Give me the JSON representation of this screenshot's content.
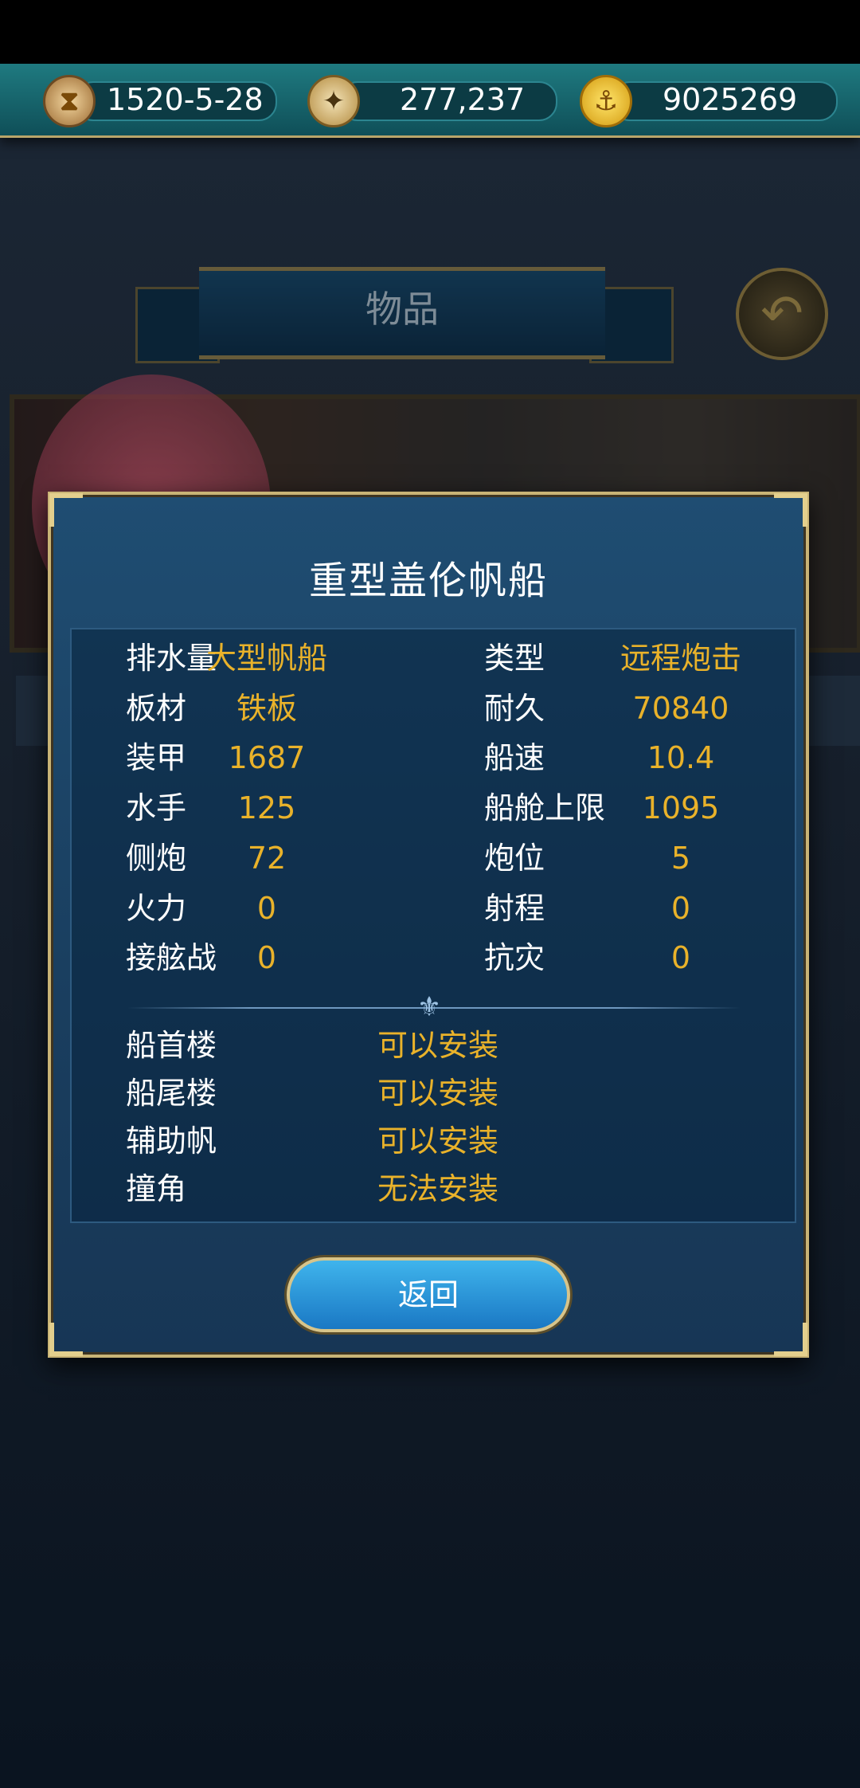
{
  "topbar": {
    "date": "1520-5-28",
    "compass_value": "277,237",
    "coins_value": "9025269",
    "date_icon": "hourglass-icon",
    "compass_icon": "compass-icon",
    "coin_icon": "anchor-coin-icon"
  },
  "page": {
    "title": "物品",
    "back_icon": "back-arrow-icon"
  },
  "modal": {
    "title": "重型盖伦帆船",
    "stats": [
      {
        "label": "排水量",
        "value": "大型帆船",
        "label2": "类型",
        "value2": "远程炮击"
      },
      {
        "label": "板材",
        "value": "铁板",
        "label2": "耐久",
        "value2": "70840"
      },
      {
        "label": "装甲",
        "value": "1687",
        "label2": "船速",
        "value2": "10.4"
      },
      {
        "label": "水手",
        "value": "125",
        "label2": "船舱上限",
        "value2": "1095"
      },
      {
        "label": "侧炮",
        "value": "72",
        "label2": "炮位",
        "value2": "5"
      },
      {
        "label": "火力",
        "value": "0",
        "label2": "射程",
        "value2": "0"
      },
      {
        "label": "接舷战",
        "value": "0",
        "label2": "抗灾",
        "value2": "0"
      }
    ],
    "installs": [
      {
        "label": "船首楼",
        "status": "可以安装"
      },
      {
        "label": "船尾楼",
        "status": "可以安装"
      },
      {
        "label": "辅助帆",
        "status": "可以安装"
      },
      {
        "label": "撞角",
        "status": "无法安装"
      }
    ],
    "return_label": "返回"
  },
  "colors": {
    "gold_text": "#e9b22a",
    "modal_border": "#c9b476",
    "button_blue": "#2a97dd"
  }
}
